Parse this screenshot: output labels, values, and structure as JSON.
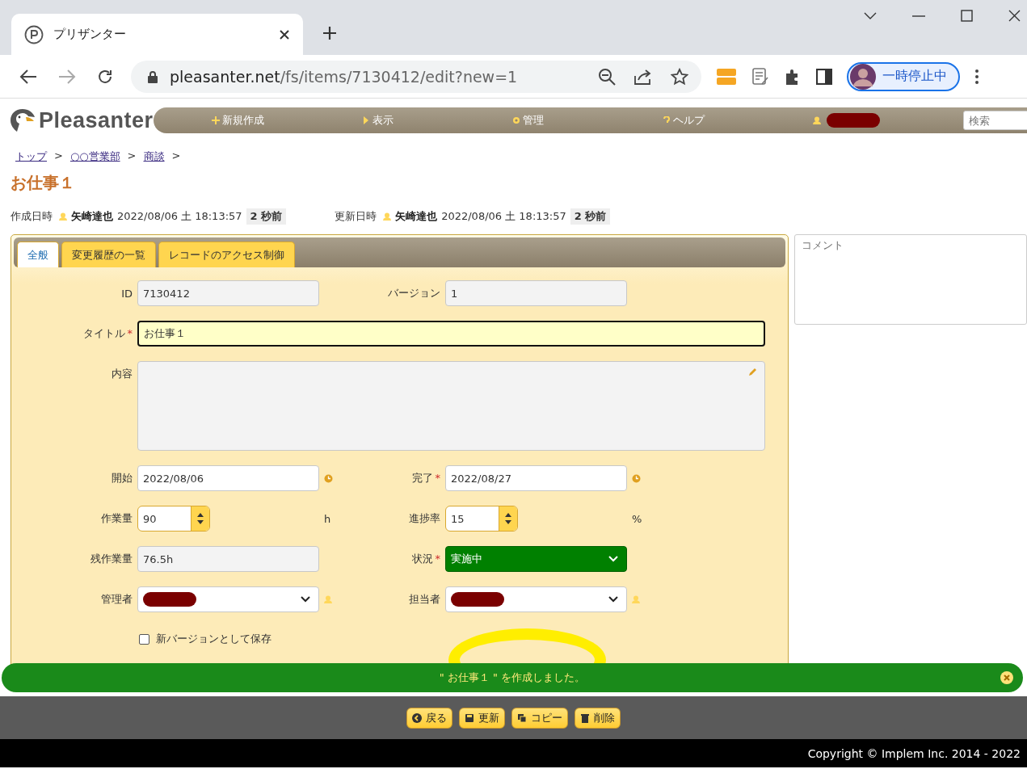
{
  "browser": {
    "tab_title": "プリザンター",
    "url_host": "pleasanter.net",
    "url_path": "/fs/items/7130412/edit?new=1",
    "profile_label": "一時停止中"
  },
  "header": {
    "logo_text": "Pleasanter",
    "nav": [
      {
        "label": "新規作成",
        "kind": "plus"
      },
      {
        "label": "表示",
        "kind": "triangle"
      },
      {
        "label": "管理",
        "kind": "gear"
      },
      {
        "label": "ヘルプ",
        "kind": "question"
      },
      {
        "kind": "user"
      }
    ],
    "search": {
      "placeholder": "検索"
    }
  },
  "breadcrumb": {
    "items": [
      "トップ",
      "○○営業部",
      "商談"
    ],
    "separator": ">"
  },
  "title": "お仕事１",
  "info": [
    {
      "label": "作成日時",
      "user": "矢崎達也",
      "datetime": "2022/08/06 土 18:13:57",
      "ago": "2 秒前"
    },
    {
      "label": "更新日時",
      "user": "矢崎達也",
      "datetime": "2022/08/06 土 18:13:57",
      "ago": "2 秒前"
    }
  ],
  "tabs": [
    {
      "label": "全般",
      "selected": true
    },
    {
      "label": "変更履歴の一覧",
      "selected": false
    },
    {
      "label": "レコードのアクセス制御",
      "selected": false
    }
  ],
  "rows": [
    {
      "fields": [
        {
          "label": "ID",
          "kind": "readonly",
          "value": "7130412"
        },
        {
          "label": "バージョン",
          "kind": "readonly",
          "value": "1"
        }
      ]
    },
    {
      "fields": [
        {
          "label": "タイトル",
          "required_mark": "*",
          "kind": "title",
          "value": "お仕事１"
        }
      ]
    },
    {
      "fields": [
        {
          "label": "内容",
          "kind": "textarea"
        }
      ]
    },
    {
      "fields": [
        {
          "label": "開始",
          "kind": "date",
          "value": "2022/08/06"
        },
        {
          "label": "完了",
          "required_mark": "*",
          "kind": "date",
          "value": "2022/08/27"
        }
      ]
    },
    {
      "fields": [
        {
          "label": "作業量",
          "kind": "spinner",
          "value": "90",
          "unit": "h"
        },
        {
          "label": "進捗率",
          "kind": "spinner",
          "value": "15",
          "unit": "%"
        }
      ]
    },
    {
      "fields": [
        {
          "label": "残作業量",
          "kind": "readonly",
          "value": "76.5h"
        },
        {
          "label": "状況",
          "required_mark": "*",
          "kind": "status",
          "value": "実施中"
        }
      ]
    },
    {
      "fields": [
        {
          "label": "管理者",
          "kind": "user"
        },
        {
          "label": "担当者",
          "kind": "user"
        }
      ]
    }
  ],
  "checkbox": {
    "label": "新バージョンとして保存",
    "checked": false
  },
  "comment": {
    "placeholder": "コメント"
  },
  "toast": {
    "message": "\" お仕事１ \" を作成しました。"
  },
  "buttons": [
    {
      "label": "戻る",
      "kind": "back"
    },
    {
      "label": "更新",
      "kind": "save"
    },
    {
      "label": "コピー",
      "kind": "copy"
    },
    {
      "label": "削除",
      "kind": "delete"
    }
  ],
  "footer": "Copyright © Implem Inc. 2014 - 2022"
}
